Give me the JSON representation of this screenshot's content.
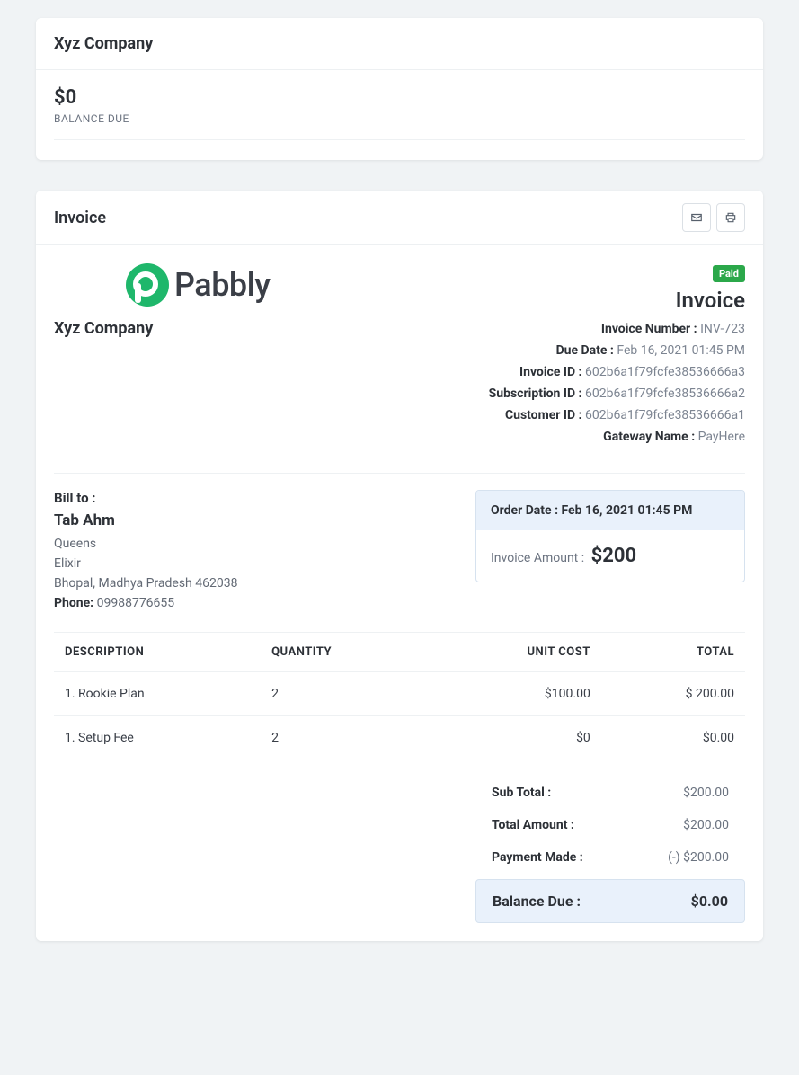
{
  "summary": {
    "company": "Xyz Company",
    "balance_amount": "$0",
    "balance_label": "BALANCE DUE"
  },
  "invoice_section": {
    "title": "Invoice",
    "logo_text": "Pabbly",
    "company": "Xyz Company",
    "status_badge": "Paid",
    "heading": "Invoice",
    "meta": {
      "invoice_number_label": "Invoice Number :",
      "invoice_number": "INV-723",
      "due_date_label": "Due Date :",
      "due_date": "Feb 16, 2021 01:45 PM",
      "invoice_id_label": "Invoice ID :",
      "invoice_id": "602b6a1f79fcfe38536666a3",
      "subscription_id_label": "Subscription ID :",
      "subscription_id": "602b6a1f79fcfe38536666a2",
      "customer_id_label": "Customer ID :",
      "customer_id": "602b6a1f79fcfe38536666a1",
      "gateway_label": "Gateway Name :",
      "gateway": "PayHere"
    },
    "bill_to": {
      "label": "Bill to :",
      "name": "Tab Ahm",
      "line1": "Queens",
      "line2": "Elixir",
      "line3": "Bhopal, Madhya Pradesh 462038",
      "phone_label": "Phone:",
      "phone": "09988776655"
    },
    "order": {
      "date_label": "Order Date :",
      "date": "Feb 16, 2021 01:45 PM",
      "amount_label": "Invoice Amount :",
      "amount": "$200"
    },
    "table": {
      "headers": [
        "DESCRIPTION",
        "QUANTITY",
        "UNIT COST",
        "TOTAL"
      ],
      "rows": [
        {
          "desc": "1. Rookie Plan",
          "qty": "2",
          "unit": "$100.00",
          "total": "$ 200.00"
        },
        {
          "desc": "1. Setup Fee",
          "qty": "2",
          "unit": "$0",
          "total": "$0.00"
        }
      ]
    },
    "totals": {
      "subtotal_label": "Sub Total :",
      "subtotal": "$200.00",
      "total_amount_label": "Total Amount :",
      "total_amount": "$200.00",
      "payment_made_label": "Payment Made :",
      "payment_made": "(-) $200.00",
      "balance_due_label": "Balance Due :",
      "balance_due": "$0.00"
    }
  }
}
